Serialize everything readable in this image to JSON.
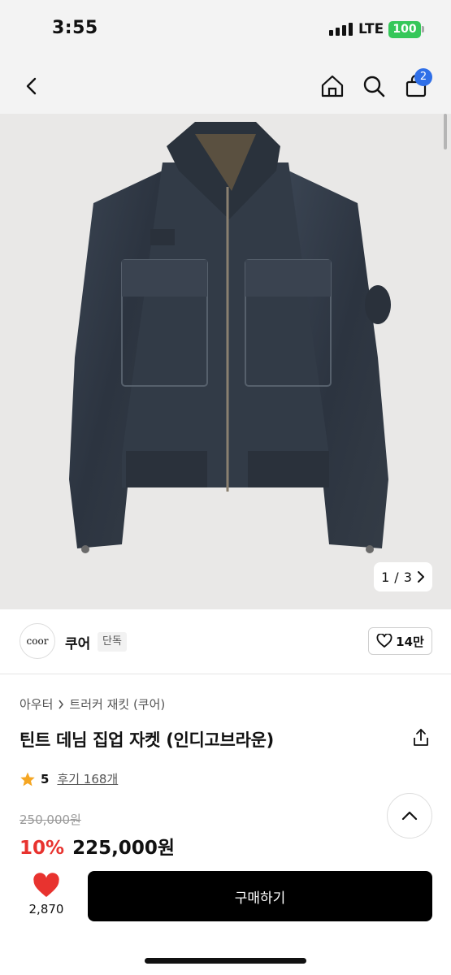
{
  "status_bar": {
    "time": "3:55",
    "network": "LTE",
    "battery": "100"
  },
  "nav": {
    "cart_count": "2"
  },
  "gallery": {
    "current": "1",
    "separator": "/",
    "total": "3"
  },
  "brand": {
    "logo_text": "coor",
    "name": "쿠어",
    "badge": "단독",
    "likes": "14만"
  },
  "product": {
    "breadcrumb": [
      "아우터",
      "트러커 재킷 (쿠어)"
    ],
    "title": "틴트 데님 집업 자켓 (인디고브라운)",
    "rating": "5",
    "reviews": "후기 168개",
    "original_price": "250,000원",
    "discount": "10%",
    "price": "225,000원"
  },
  "bottom": {
    "wish_count": "2,870",
    "buy_label": "구매하기"
  },
  "colors": {
    "accent_red": "#e8332f",
    "badge_blue": "#2f6fe8",
    "battery_green": "#35c759",
    "star": "#f5a623"
  },
  "icons": [
    "back-arrow-icon",
    "home-icon",
    "search-icon",
    "cart-icon",
    "heart-outline-icon",
    "chevron-right-icon",
    "share-icon",
    "star-icon",
    "chevron-up-icon",
    "heart-filled-icon"
  ]
}
